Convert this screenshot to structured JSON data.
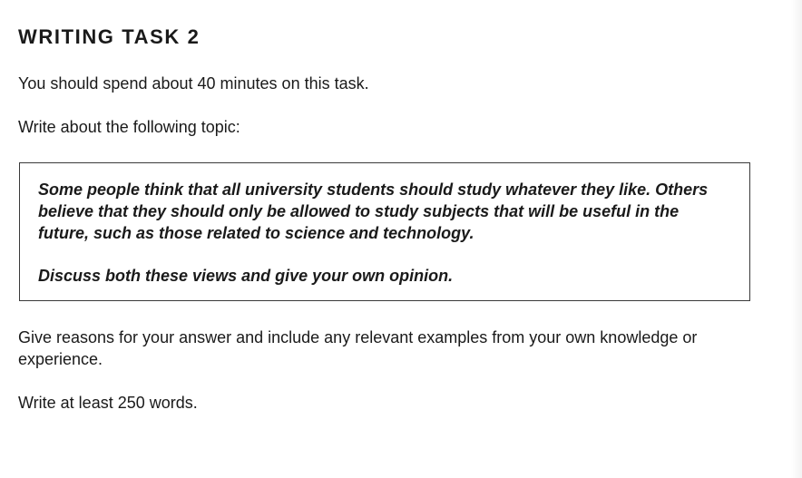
{
  "heading": "WRITING TASK 2",
  "time_instruction": "You should spend about 40 minutes on this task.",
  "topic_intro": "Write about the following topic:",
  "topic_box": {
    "statement": "Some people think that all university students should study whatever they like. Others believe that they should only be allowed to study subjects that will be useful in the future, such as those related to science and technology.",
    "prompt": "Discuss both these views and give your own opinion."
  },
  "answer_instruction": "Give reasons for your answer and include any relevant examples from your own knowledge or experience.",
  "word_count_instruction": "Write at least 250 words."
}
